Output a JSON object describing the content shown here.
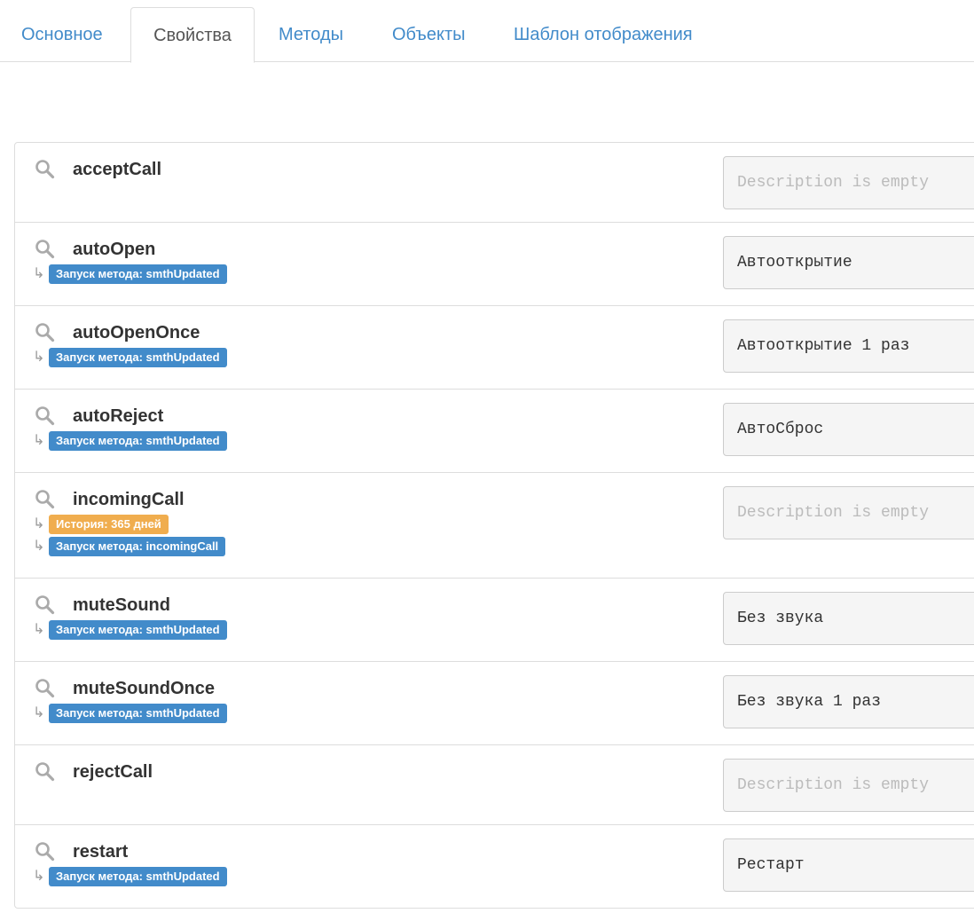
{
  "tabs": [
    {
      "label": "Основное",
      "active": false
    },
    {
      "label": "Свойства",
      "active": true
    },
    {
      "label": "Методы",
      "active": false
    },
    {
      "label": "Объекты",
      "active": false
    },
    {
      "label": "Шаблон отображения",
      "active": false
    }
  ],
  "properties": [
    {
      "name": "acceptCall",
      "badges": [],
      "description": "",
      "placeholder": "Description is empty"
    },
    {
      "name": "autoOpen",
      "badges": [
        {
          "text": "Запуск метода: smthUpdated",
          "color": "blue"
        }
      ],
      "description": "Автооткрытие",
      "placeholder": "Description is empty"
    },
    {
      "name": "autoOpenOnce",
      "badges": [
        {
          "text": "Запуск метода: smthUpdated",
          "color": "blue"
        }
      ],
      "description": "Автооткрытие 1 раз",
      "placeholder": "Description is empty"
    },
    {
      "name": "autoReject",
      "badges": [
        {
          "text": "Запуск метода: smthUpdated",
          "color": "blue"
        }
      ],
      "description": "АвтоСброс",
      "placeholder": "Description is empty"
    },
    {
      "name": "incomingCall",
      "badges": [
        {
          "text": "История: 365 дней",
          "color": "orange"
        },
        {
          "text": "Запуск метода: incomingCall",
          "color": "blue"
        }
      ],
      "description": "",
      "placeholder": "Description is empty"
    },
    {
      "name": "muteSound",
      "badges": [
        {
          "text": "Запуск метода: smthUpdated",
          "color": "blue"
        }
      ],
      "description": "Без звука",
      "placeholder": "Description is empty"
    },
    {
      "name": "muteSoundOnce",
      "badges": [
        {
          "text": "Запуск метода: smthUpdated",
          "color": "blue"
        }
      ],
      "description": "Без звука 1 раз",
      "placeholder": "Description is empty"
    },
    {
      "name": "rejectCall",
      "badges": [],
      "description": "",
      "placeholder": "Description is empty"
    },
    {
      "name": "restart",
      "badges": [
        {
          "text": "Запуск метода: smthUpdated",
          "color": "blue"
        }
      ],
      "description": "Рестарт",
      "placeholder": "Description is empty"
    }
  ],
  "colors": {
    "link": "#428bca",
    "badge_blue": "#428bca",
    "badge_orange": "#f0ad4e",
    "border": "#dddddd",
    "input_bg": "#f5f5f5"
  },
  "icons": {
    "row": "search-icon",
    "badge_prefix": "return-arrow-icon"
  }
}
